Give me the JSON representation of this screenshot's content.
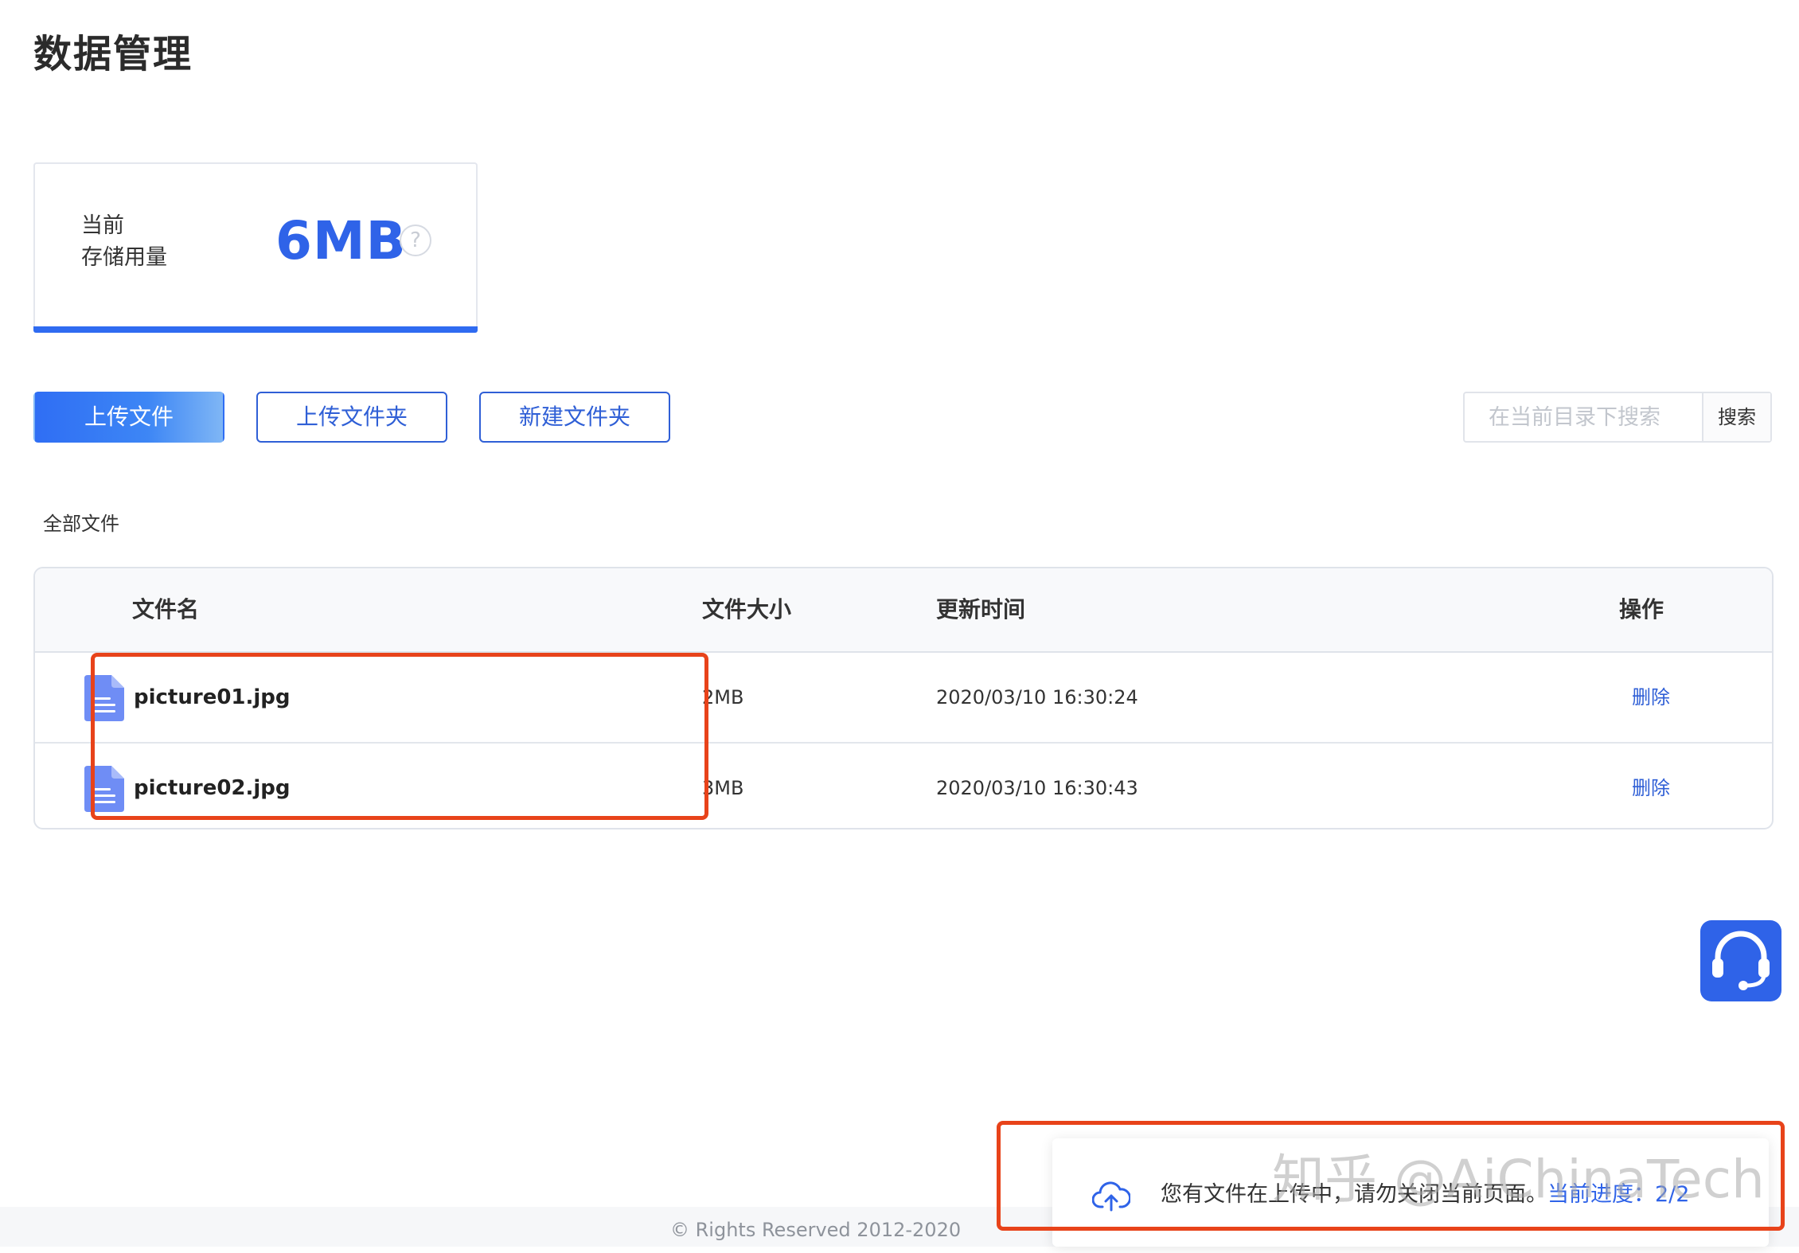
{
  "page": {
    "title": "数据管理"
  },
  "storage": {
    "label_line1": "当前",
    "label_line2": "存储用量",
    "value": "6MB",
    "help": "?"
  },
  "toolbar": {
    "upload_file": "上传文件",
    "upload_folder": "上传文件夹",
    "new_folder": "新建文件夹"
  },
  "search": {
    "placeholder": "在当前目录下搜索",
    "button": "搜索"
  },
  "breadcrumb": "全部文件",
  "table": {
    "columns": {
      "name": "文件名",
      "size": "文件大小",
      "time": "更新时间",
      "action": "操作"
    },
    "rows": [
      {
        "name": "picture01.jpg",
        "size": "2MB",
        "time": "2020/03/10 16:30:24",
        "action": "删除"
      },
      {
        "name": "picture02.jpg",
        "size": "3MB",
        "time": "2020/03/10 16:30:43",
        "action": "删除"
      }
    ]
  },
  "toast": {
    "message": "您有文件在上传中，请勿关闭当前页面。",
    "progress_label": "当前进度：",
    "progress_value": "2/2"
  },
  "footer": {
    "copyright": "© Rights Reserved 2012-2020"
  },
  "watermark": "知乎 @AiChinaTech",
  "colors": {
    "accent": "#2f63e8",
    "annotation": "#e8431a",
    "file_icon": "#6f8df5"
  }
}
